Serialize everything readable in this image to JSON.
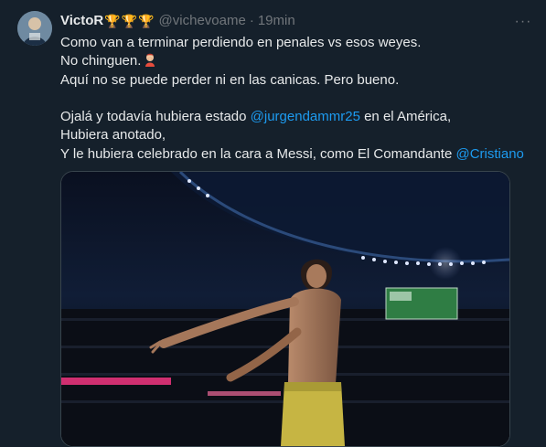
{
  "tweet": {
    "author_name": "VictoR",
    "name_badges": [
      "trophy-icon",
      "trophy-icon",
      "trophy-icon"
    ],
    "handle": "@vichevoame",
    "separator": "·",
    "timestamp": "19min",
    "more_label": "···",
    "lines": {
      "l1": "Como van a terminar perdiendo en penales vs esos weyes.",
      "l2": "No chinguen.",
      "l3": "Aquí no se puede perder ni en las canicas. Pero bueno.",
      "l4a": "Ojalá y todavía hubiera estado ",
      "l4_mention": "@jurgendammr25",
      "l4b": " en el América,",
      "l5": "Hubiera anotado,",
      "l6a": "Y le hubiera celebrado en la cara a Messi, como El Comandante ",
      "l6_mention": "@Cristiano"
    },
    "emoji": "person-facepalming-icon",
    "media": "photo of a shirtless player in yellow shorts celebrating in a lit stadium"
  },
  "colors": {
    "background": "#15202b",
    "text": "#e7e9ea",
    "secondary": "#71767b",
    "link": "#1d9bf0",
    "trophy": "#f2c12e",
    "border": "#38444d"
  }
}
